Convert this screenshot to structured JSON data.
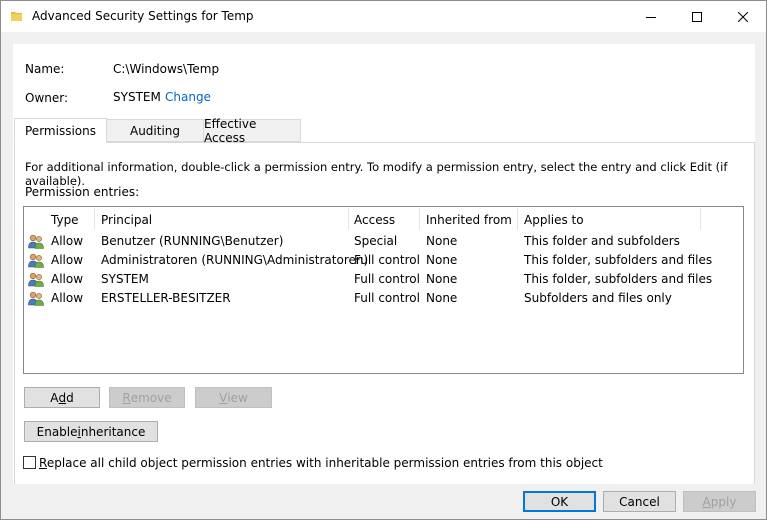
{
  "window": {
    "title": "Advanced Security Settings for Temp"
  },
  "object": {
    "name_label": "Name:",
    "name_value": "C:\\Windows\\Temp",
    "owner_label": "Owner:",
    "owner_value": "SYSTEM",
    "change_link": "Change"
  },
  "tabs": [
    {
      "label": "Permissions",
      "active": true
    },
    {
      "label": "Auditing",
      "active": false
    },
    {
      "label": "Effective Access",
      "active": false
    }
  ],
  "permissions": {
    "info_text": "For additional information, double-click a permission entry. To modify a permission entry, select the entry and click Edit (if available).",
    "entries_label": "Permission entries:",
    "columns": [
      "Type",
      "Principal",
      "Access",
      "Inherited from",
      "Applies to"
    ],
    "rows": [
      {
        "type": "Allow",
        "principal": "Benutzer (RUNNING\\Benutzer)",
        "access": "Special",
        "inherited_from": "None",
        "applies_to": "This folder and subfolders"
      },
      {
        "type": "Allow",
        "principal": "Administratoren (RUNNING\\Administratoren)",
        "access": "Full control",
        "inherited_from": "None",
        "applies_to": "This folder, subfolders and files"
      },
      {
        "type": "Allow",
        "principal": "SYSTEM",
        "access": "Full control",
        "inherited_from": "None",
        "applies_to": "This folder, subfolders and files"
      },
      {
        "type": "Allow",
        "principal": "ERSTELLER-BESITZER",
        "access": "Full control",
        "inherited_from": "None",
        "applies_to": "Subfolders and files only"
      }
    ],
    "buttons": {
      "add": {
        "pre": "A",
        "ul": "d",
        "post": "d"
      },
      "remove": {
        "pre": "",
        "ul": "R",
        "post": "emove"
      },
      "view": {
        "pre": "",
        "ul": "V",
        "post": "iew"
      },
      "enable_inheritance": {
        "pre": "Enable ",
        "ul": "i",
        "post": "nheritance"
      }
    },
    "replace_checkbox": {
      "pre": "",
      "ul": "R",
      "post": "eplace all child object permission entries with inheritable permission entries from this object",
      "checked": false
    }
  },
  "footer": {
    "ok": "OK",
    "cancel": "Cancel",
    "apply": {
      "pre": "",
      "ul": "A",
      "post": "pply"
    }
  },
  "colors": {
    "link": "#0066cc",
    "accent": "#0078d7",
    "disabled_text": "#a0a0a0"
  }
}
